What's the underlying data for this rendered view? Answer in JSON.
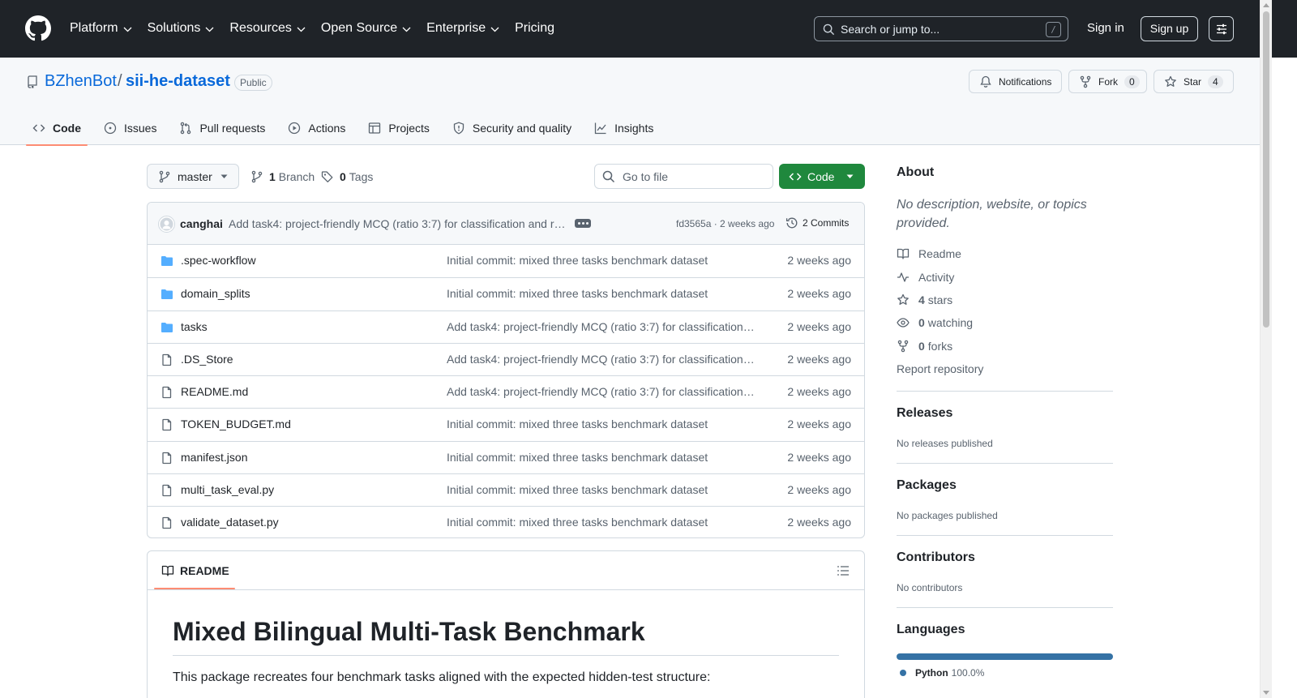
{
  "header": {
    "nav": [
      {
        "label": "Platform",
        "has_menu": true
      },
      {
        "label": "Solutions",
        "has_menu": true
      },
      {
        "label": "Resources",
        "has_menu": true
      },
      {
        "label": "Open Source",
        "has_menu": true
      },
      {
        "label": "Enterprise",
        "has_menu": true
      },
      {
        "label": "Pricing",
        "has_menu": false
      }
    ],
    "search_placeholder": "Search or jump to...",
    "search_shortcut": "/",
    "signin_label": "Sign in",
    "signup_label": "Sign up",
    "icons": {
      "logo": "github-mark-icon",
      "menu": "sliders-icon"
    }
  },
  "repo": {
    "owner": "BZhenBot",
    "separator": "/",
    "name": "sii-he-dataset",
    "visibility": "Public",
    "notifications_label": "Notifications",
    "fork_label": "Fork",
    "fork_count": "0",
    "star_label": "Star",
    "star_count": "4",
    "tabs": [
      {
        "label": "Code",
        "icon": "code-icon",
        "active": true
      },
      {
        "label": "Issues",
        "icon": "issue-opened-icon",
        "active": false
      },
      {
        "label": "Pull requests",
        "icon": "git-pull-request-icon",
        "active": false
      },
      {
        "label": "Actions",
        "icon": "play-icon",
        "active": false
      },
      {
        "label": "Projects",
        "icon": "table-icon",
        "active": false
      },
      {
        "label": "Security and quality",
        "icon": "shield-icon",
        "active": false
      },
      {
        "label": "Insights",
        "icon": "graph-icon",
        "active": false
      }
    ]
  },
  "toolbar": {
    "branch": "master",
    "branch_count": "1",
    "branch_label": "Branch",
    "tag_count": "0",
    "tag_label": "Tags",
    "goto_placeholder": "Go to file",
    "code_button": "Code"
  },
  "latest_commit": {
    "author": "canghai",
    "message": "Add task4: project-friendly MCQ (ratio 3:7) for classification and ro…",
    "sha_age": "fd3565a · 2 weeks ago",
    "commits_label": "2 Commits"
  },
  "files": [
    {
      "type": "dir",
      "name": ".spec-workflow",
      "message": "Initial commit: mixed three tasks benchmark dataset",
      "age": "2 weeks ago"
    },
    {
      "type": "dir",
      "name": "domain_splits",
      "message": "Initial commit: mixed three tasks benchmark dataset",
      "age": "2 weeks ago"
    },
    {
      "type": "dir",
      "name": "tasks",
      "message": "Add task4: project-friendly MCQ (ratio 3:7) for classification …",
      "age": "2 weeks ago"
    },
    {
      "type": "file",
      "name": ".DS_Store",
      "message": "Add task4: project-friendly MCQ (ratio 3:7) for classification …",
      "age": "2 weeks ago"
    },
    {
      "type": "file",
      "name": "README.md",
      "message": "Add task4: project-friendly MCQ (ratio 3:7) for classification …",
      "age": "2 weeks ago"
    },
    {
      "type": "file",
      "name": "TOKEN_BUDGET.md",
      "message": "Initial commit: mixed three tasks benchmark dataset",
      "age": "2 weeks ago"
    },
    {
      "type": "file",
      "name": "manifest.json",
      "message": "Initial commit: mixed three tasks benchmark dataset",
      "age": "2 weeks ago"
    },
    {
      "type": "file",
      "name": "multi_task_eval.py",
      "message": "Initial commit: mixed three tasks benchmark dataset",
      "age": "2 weeks ago"
    },
    {
      "type": "file",
      "name": "validate_dataset.py",
      "message": "Initial commit: mixed three tasks benchmark dataset",
      "age": "2 weeks ago"
    }
  ],
  "readme": {
    "tab_label": "README",
    "title": "Mixed Bilingual Multi-Task Benchmark",
    "intro": "This package recreates four benchmark tasks aligned with the expected hidden-test structure:"
  },
  "sidebar": {
    "about_title": "About",
    "about_desc": "No description, website, or topics provided.",
    "readme_label": "Readme",
    "activity_label": "Activity",
    "stars_count": "4",
    "stars_label": "stars",
    "watching_count": "0",
    "watching_label": "watching",
    "forks_count": "0",
    "forks_label": "forks",
    "report_label": "Report repository",
    "releases_title": "Releases",
    "releases_empty": "No releases published",
    "packages_title": "Packages",
    "packages_empty": "No packages published",
    "contributors_title": "Contributors",
    "contributors_empty": "No contributors",
    "languages_title": "Languages",
    "languages": [
      {
        "name": "Python",
        "percent": "100.0%",
        "color": "#3572a5"
      }
    ]
  },
  "colors": {
    "header_bg": "#1f2328",
    "link": "#0969da",
    "primary_button": "#1f883d",
    "tab_underline": "#fd8c73",
    "folder": "#54aeff"
  }
}
